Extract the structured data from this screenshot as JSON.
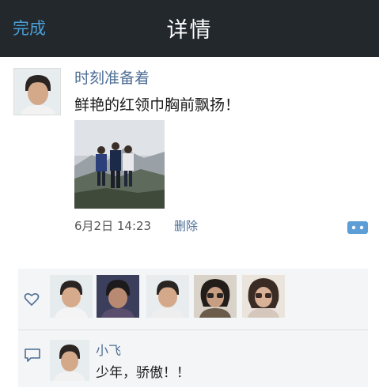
{
  "navbar": {
    "done_label": "完成",
    "title": "详情"
  },
  "post": {
    "username": "时刻准备着",
    "text": "鲜艳的红领巾胸前飘扬！",
    "time": "6月2日 14:23",
    "delete_label": "删除"
  },
  "comment": {
    "author": "小飞",
    "text": "少年，骄傲！！"
  },
  "colors": {
    "navbar_bg": "#23282d",
    "accent_blue": "#4a9fd8",
    "link_blue": "#4d6d95",
    "panel_bg": "#f4f5f6"
  },
  "icons": [
    "heart-icon",
    "comment-bubble-icon",
    "comment-toggle-icon"
  ]
}
